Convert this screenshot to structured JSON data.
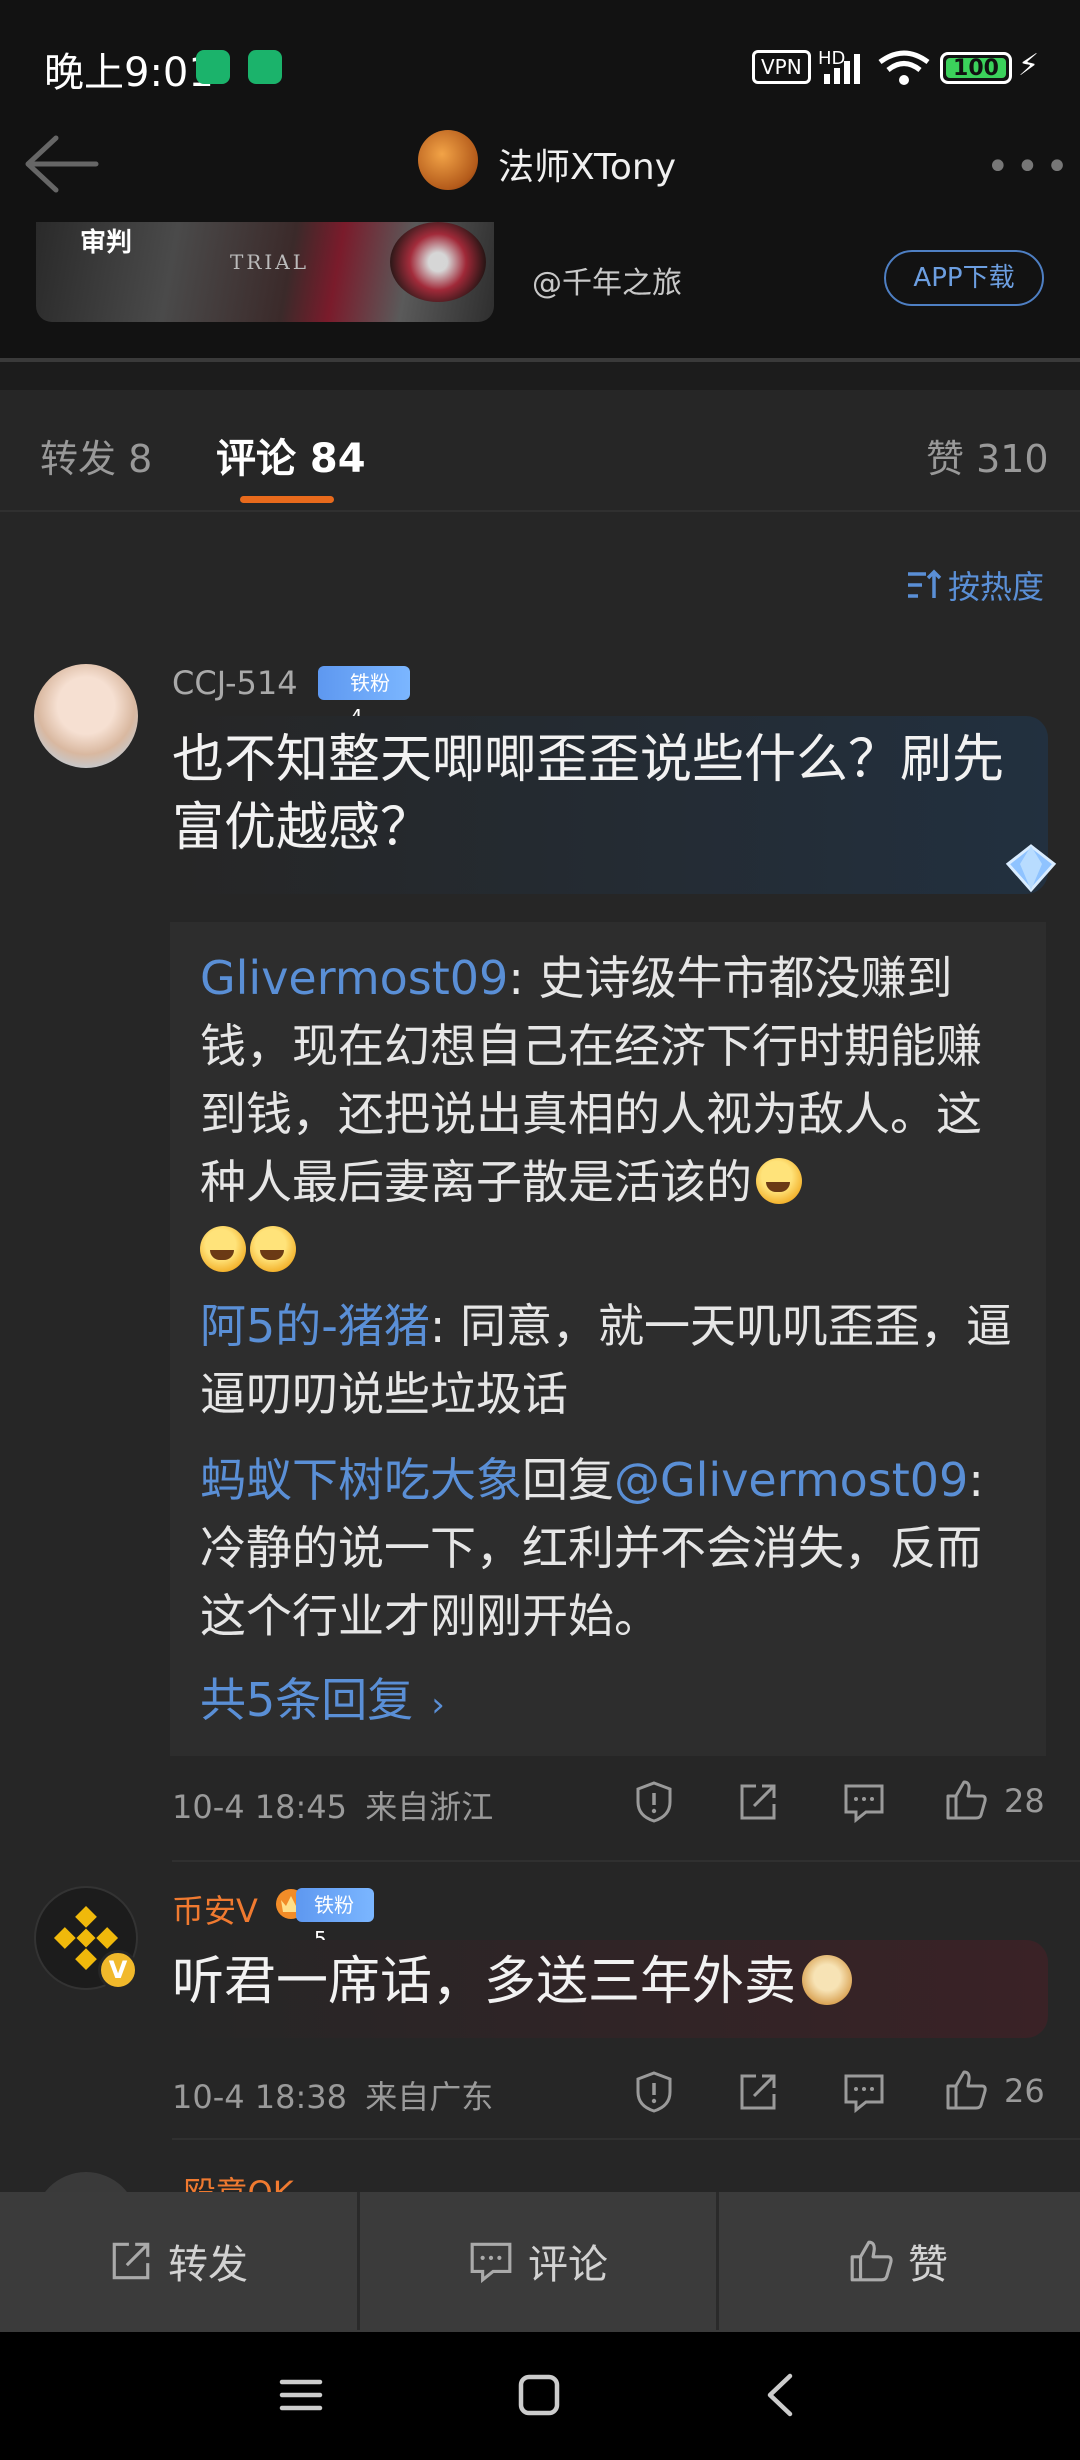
{
  "status_bar": {
    "time": "晚上9:01",
    "vpn": "VPN",
    "network": "HD",
    "battery": "100"
  },
  "header": {
    "title": "法师XTony"
  },
  "card": {
    "account": "@千年之旅",
    "app_button": "APP下载",
    "thumb_text": "TRIAL",
    "thumb_mark": "审判"
  },
  "tabs": {
    "repost": "转发 8",
    "comment": "评论 84",
    "like": "赞 310"
  },
  "sort": {
    "label": "按热度"
  },
  "comments": [
    {
      "name": "CCJ-514",
      "badge": "铁粉4",
      "text": "也不知整天唧唧歪歪说些什么？刷先富优越感？",
      "replies": [
        {
          "name": "Glivermost09",
          "sep": ": ",
          "text": "史诗级牛市都没赚到钱，现在幻想自己在经济下行时期能赚到钱，还把说出真相的人视为敌人。这种人最后妻离子散是活该的"
        },
        {
          "name": "阿5的-猪猪",
          "sep": ": ",
          "text": "同意，就一天叽叽歪歪，逼逼叨叨说些垃圾话"
        },
        {
          "name": "蚂蚁下树吃大象",
          "reply_word": "回复",
          "target": "@Glivermost09",
          "sep": ": ",
          "text": "冷静的说一下，红利并不会消失，反而这个行业才刚刚开始。"
        }
      ],
      "more": "共5条回复",
      "time": "10-4 18:45",
      "location": "来自浙江",
      "likes": "28"
    },
    {
      "name": "币安V",
      "badge": "铁粉5",
      "text": "听君一席话，多送三年外卖",
      "time": "10-4 18:38",
      "location": "来自广东",
      "likes": "26"
    },
    {
      "name": "-殴意OK"
    }
  ],
  "bottom_bar": {
    "repost": "转发",
    "comment": "评论",
    "like": "赞"
  },
  "colors": {
    "accent_blue": "#5a8fd6",
    "tab_indicator": "#e86a1c",
    "vip_name": "#f07a30"
  }
}
